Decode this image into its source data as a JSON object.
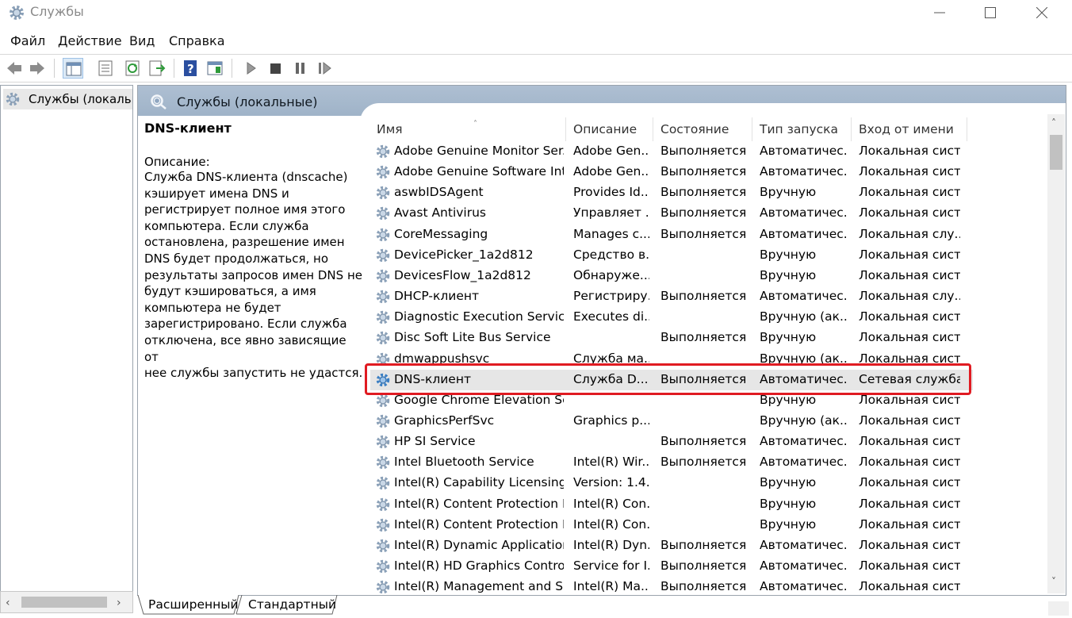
{
  "window": {
    "title": "Службы",
    "icon": "gear-icon"
  },
  "menu": {
    "items": [
      "Файл",
      "Действие",
      "Вид",
      "Справка"
    ]
  },
  "toolbar": {
    "icons": [
      "back-icon",
      "forward-icon",
      "show-console-tree-icon",
      "properties-icon",
      "refresh-icon",
      "export-list-icon",
      "help-icon",
      "show-hide-action-pane-icon",
      "start-service-icon",
      "stop-service-icon",
      "pause-service-icon",
      "resume-service-icon"
    ]
  },
  "tree": {
    "item_label": "Службы (локальн"
  },
  "pane": {
    "title": "Службы (локальные)"
  },
  "detail": {
    "name": "DNS-клиент",
    "label": "Описание:",
    "lines": [
      "Служба DNS-клиента (dnscache)",
      "кэширует имена DNS и",
      "регистрирует полное имя этого",
      "компьютера. Если служба",
      "остановлена, разрешение имен",
      "DNS будет продолжаться, но",
      "результаты запросов имен DNS не",
      "будут кэшироваться, а имя",
      "компьютера не будет",
      "зарегистрировано. Если служба",
      "отключена, все явно зависящие от",
      "нее службы запустить не удастся."
    ]
  },
  "columns": {
    "name": "Имя",
    "description": "Описание",
    "state": "Состояние",
    "startup": "Тип запуска",
    "logon": "Вход от имени"
  },
  "services": [
    {
      "name": "Adobe Genuine Monitor Ser...",
      "desc": "Adobe Gen...",
      "state": "Выполняется",
      "startup": "Автоматичес...",
      "logon": "Локальная сист..."
    },
    {
      "name": "Adobe Genuine Software Int...",
      "desc": "Adobe Gen...",
      "state": "Выполняется",
      "startup": "Автоматичес...",
      "logon": "Локальная сист..."
    },
    {
      "name": "aswbIDSAgent",
      "desc": "Provides Id...",
      "state": "Выполняется",
      "startup": "Вручную",
      "logon": "Локальная сист..."
    },
    {
      "name": "Avast Antivirus",
      "desc": "Управляет ...",
      "state": "Выполняется",
      "startup": "Автоматичес...",
      "logon": "Локальная сист..."
    },
    {
      "name": "CoreMessaging",
      "desc": "Manages c...",
      "state": "Выполняется",
      "startup": "Автоматичес...",
      "logon": "Локальная слу..."
    },
    {
      "name": "DevicePicker_1a2d812",
      "desc": "Средство в...",
      "state": "",
      "startup": "Вручную",
      "logon": "Локальная сист..."
    },
    {
      "name": "DevicesFlow_1a2d812",
      "desc": "Обнаруже...",
      "state": "",
      "startup": "Вручную",
      "logon": "Локальная сист..."
    },
    {
      "name": "DHCP-клиент",
      "desc": "Регистриру...",
      "state": "Выполняется",
      "startup": "Автоматичес...",
      "logon": "Локальная слу..."
    },
    {
      "name": "Diagnostic Execution Service",
      "desc": "Executes di...",
      "state": "",
      "startup": "Вручную (ак...",
      "logon": "Локальная сист..."
    },
    {
      "name": "Disc Soft Lite Bus Service",
      "desc": "",
      "state": "Выполняется",
      "startup": "Вручную",
      "logon": "Локальная сист..."
    },
    {
      "name": "dmwappushsvc",
      "desc": "Служба ма...",
      "state": "",
      "startup": "Вручную (ак...",
      "logon": "Локальная сист..."
    },
    {
      "name": "DNS-клиент",
      "desc": "Служба D...",
      "state": "Выполняется",
      "startup": "Автоматичес...",
      "logon": "Сетевая служба"
    },
    {
      "name": "Google Chrome Elevation Se...",
      "desc": "",
      "state": "",
      "startup": "Вручную",
      "logon": "Локальная сист..."
    },
    {
      "name": "GraphicsPerfSvc",
      "desc": "Graphics p...",
      "state": "",
      "startup": "Вручную (ак...",
      "logon": "Локальная сист..."
    },
    {
      "name": "HP SI Service",
      "desc": "",
      "state": "Выполняется",
      "startup": "Автоматичес...",
      "logon": "Локальная сист..."
    },
    {
      "name": "Intel Bluetooth Service",
      "desc": "Intel(R) Wir...",
      "state": "Выполняется",
      "startup": "Автоматичес...",
      "logon": "Локальная сист..."
    },
    {
      "name": "Intel(R) Capability Licensing ...",
      "desc": "Version: 1.4...",
      "state": "",
      "startup": "Вручную",
      "logon": "Локальная сист..."
    },
    {
      "name": "Intel(R) Content Protection H...",
      "desc": "Intel(R) Con...",
      "state": "",
      "startup": "Вручную",
      "logon": "Локальная сист..."
    },
    {
      "name": "Intel(R) Content Protection H...",
      "desc": "Intel(R) Con...",
      "state": "",
      "startup": "Вручную",
      "logon": "Локальная сист..."
    },
    {
      "name": "Intel(R) Dynamic Application...",
      "desc": "Intel(R) Dyn...",
      "state": "Выполняется",
      "startup": "Автоматичес...",
      "logon": "Локальная сист..."
    },
    {
      "name": "Intel(R) HD Graphics Control ...",
      "desc": "Service for I...",
      "state": "Выполняется",
      "startup": "Автоматичес...",
      "logon": "Локальная сист..."
    },
    {
      "name": "Intel(R) Management and Se...",
      "desc": "Intel(R) Ma...",
      "state": "Выполняется",
      "startup": "Автоматичес...",
      "logon": "Локальная сист..."
    }
  ],
  "selected_service": "DNS-клиент",
  "tabs": [
    "Расширенный",
    "Стандартный"
  ],
  "colors": {
    "header_band": "#9fb3c8",
    "highlight": "#e01b22",
    "gear": "#3b7fc4"
  }
}
